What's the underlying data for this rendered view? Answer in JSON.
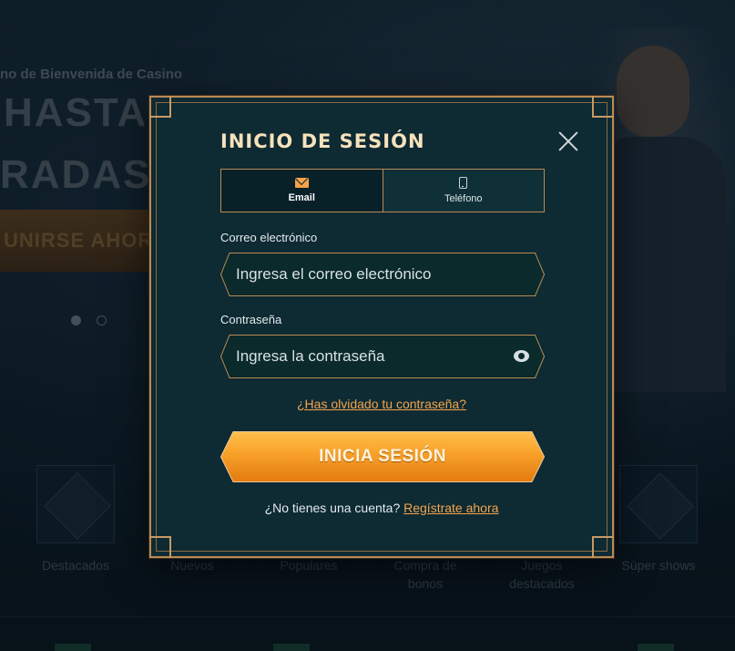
{
  "background": {
    "banner_subtitle": "no de Bienvenida de Casino",
    "banner_title_line1": "HASTA",
    "banner_title_line2": "RADAS",
    "join_button": "UNIRSE AHOR",
    "categories": [
      {
        "label": "Destacados"
      },
      {
        "label": "Nuevos"
      },
      {
        "label": "Populares"
      },
      {
        "label": "Compra de bonos"
      },
      {
        "label": "Juegos destacados"
      },
      {
        "label": "Súper shows"
      }
    ]
  },
  "modal": {
    "title": "INICIO DE SESIÓN",
    "tabs": [
      {
        "label": "Email",
        "icon": "mail-icon",
        "active": true
      },
      {
        "label": "Teléfono",
        "icon": "phone-icon",
        "active": false
      }
    ],
    "email": {
      "label": "Correo electrónico",
      "placeholder": "Ingresa el correo electrónico",
      "value": ""
    },
    "password": {
      "label": "Contraseña",
      "placeholder": "Ingresa la contraseña",
      "value": ""
    },
    "forgot_link": "¿Has olvidado tu contraseña?",
    "login_button": "INICIA SESIÓN",
    "register_prompt": "¿No tienes una cuenta?",
    "register_link": "Regístrate ahora"
  },
  "colors": {
    "accent": "#f3a54c",
    "border_gold": "#b98a55",
    "modal_bg": "#0e2a33"
  }
}
